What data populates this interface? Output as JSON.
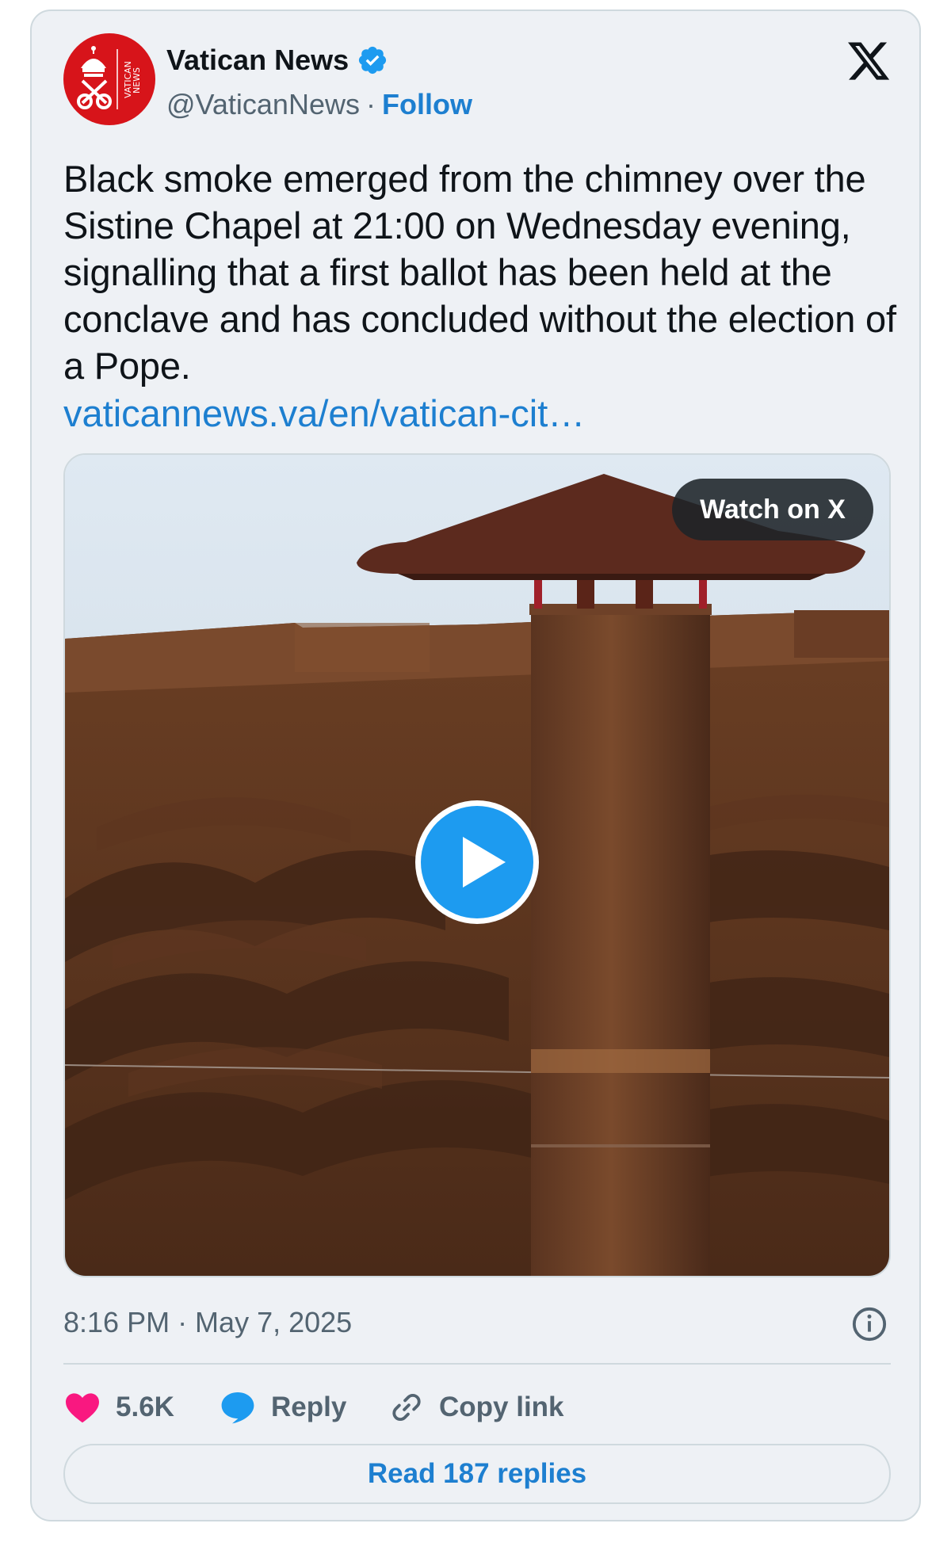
{
  "author": {
    "display_name": "Vatican News",
    "handle": "@VaticanNews",
    "separator": "·",
    "follow_label": "Follow",
    "avatar_text": "VATICAN NEWS",
    "verified_color": "#1d9bf0"
  },
  "platform": {
    "logo_icon": "x-logo-icon"
  },
  "tweet": {
    "text": "Black smoke emerged from the chimney over the Sistine Chapel at 21:00 on Wednesday evening, signalling that a first ballot has been held at the conclave and has concluded without the election of a Pope.",
    "link": "vaticannews.va/en/vatican-cit…"
  },
  "media": {
    "watch_label": "Watch on X",
    "play_icon": "play-icon"
  },
  "meta": {
    "timestamp": "8:16 PM · May 7, 2025",
    "info_icon": "info-icon"
  },
  "actions": {
    "like_count": "5.6K",
    "reply_label": "Reply",
    "copy_label": "Copy link",
    "like_color": "#f91880",
    "reply_color": "#1d9bf0"
  },
  "read_replies_label": "Read 187 replies"
}
